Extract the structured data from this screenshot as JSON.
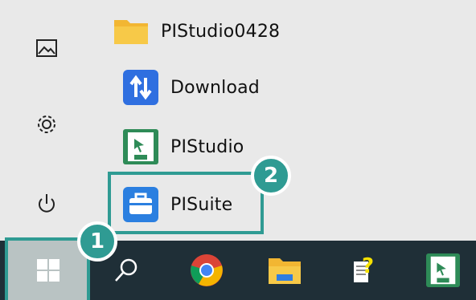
{
  "start_menu": {
    "apps": [
      {
        "label": "PIStudio0428",
        "icon": "folder-icon"
      },
      {
        "label": "Download",
        "icon": "download-app-icon"
      },
      {
        "label": "PIStudio",
        "icon": "pistudio-app-icon"
      },
      {
        "label": "PISuite",
        "icon": "pisuite-app-icon"
      }
    ],
    "left_rail": [
      {
        "icon": "pictures-icon"
      },
      {
        "icon": "settings-gear-icon"
      },
      {
        "icon": "power-icon"
      }
    ]
  },
  "taskbar": {
    "items": [
      {
        "icon": "windows-start-icon"
      },
      {
        "icon": "search-icon"
      },
      {
        "icon": "chrome-icon"
      },
      {
        "icon": "file-explorer-icon"
      },
      {
        "icon": "help-document-icon"
      },
      {
        "icon": "pistudio-taskbar-icon"
      }
    ]
  },
  "annotations": {
    "step1": "1",
    "step2": "2"
  },
  "colors": {
    "accent": "#2f9b93",
    "taskbar": "#1f2f37",
    "menu_bg": "#e9e9e9",
    "start_button_active": "#b9c3c3"
  }
}
